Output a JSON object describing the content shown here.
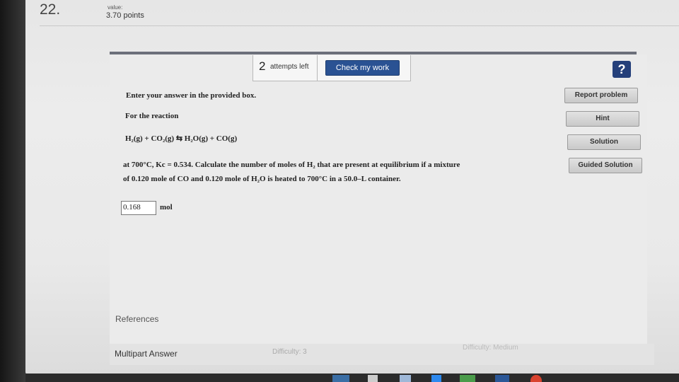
{
  "question": {
    "number": "22.",
    "value_label": "value:",
    "points": "3.70 points"
  },
  "toolbar": {
    "attempts_count": "2",
    "attempts_label": "attempts left",
    "check_label": "Check my work",
    "help_label": "?"
  },
  "sidebar": {
    "items": [
      {
        "label": "Report problem"
      },
      {
        "label": "Hint"
      },
      {
        "label": "Solution"
      },
      {
        "label": "Guided Solution"
      }
    ]
  },
  "content": {
    "instructions": "Enter your answer in the provided box.",
    "for_reaction": "For the reaction",
    "reaction": "H₂(g) + CO₂(g) ⇆ H₂O(g) + CO(g)",
    "problem_line1": "at 700°C, Kc = 0.534. Calculate the number of moles of H₂ that are present at equilibrium if a mixture",
    "problem_line2": "of 0.120 mole of CO and 0.120 mole of H₂O is heated to 700°C in a 50.0–L container.",
    "answer_value": "0.168",
    "answer_unit": "mol",
    "references": "References"
  },
  "footer": {
    "multipart": "Multipart Answer",
    "difficulty_left": "Difficulty: 3",
    "difficulty_right": "Difficulty: Medium"
  },
  "colors": {
    "check_button": "#2a5293",
    "help_button": "#243f7a",
    "panel_bar": "#6c6f7a"
  }
}
